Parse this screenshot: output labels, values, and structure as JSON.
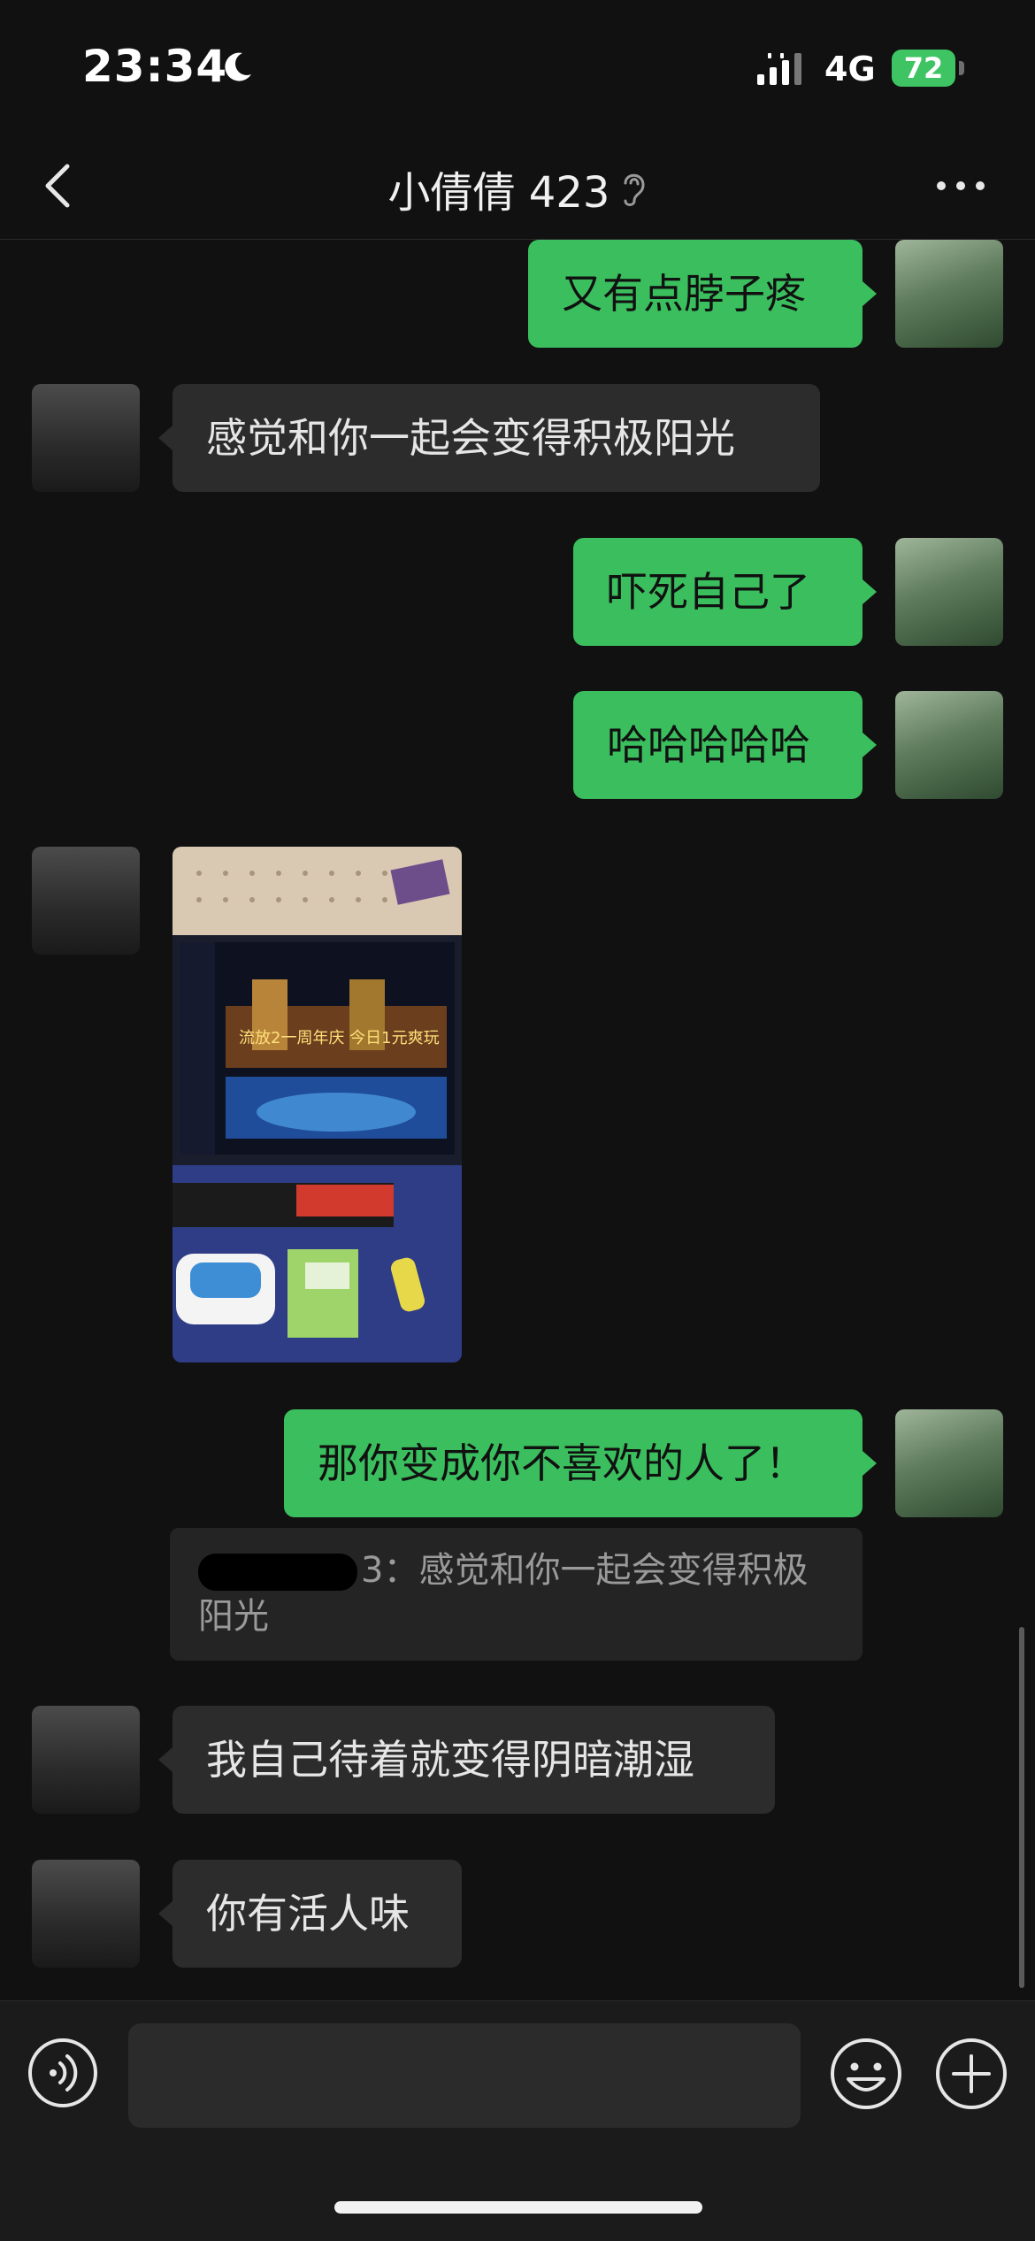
{
  "status_bar": {
    "time": "23:34",
    "network": "4G",
    "battery": "72"
  },
  "header": {
    "title": "小倩倩 423",
    "back_icon": "chevron-left-icon",
    "ear_icon": "ear-icon",
    "more_icon": "more-dots-icon"
  },
  "messages": [
    {
      "side": "out",
      "text": "又有点脖子疼"
    },
    {
      "side": "in",
      "text": "感觉和你一起会变得积极阳光"
    },
    {
      "side": "out",
      "text": "吓死自己了"
    },
    {
      "side": "out",
      "text": "哈哈哈哈哈"
    },
    {
      "side": "in",
      "type": "image",
      "image_caption": "流放2一周年庆 今日1元爽玩"
    },
    {
      "side": "out",
      "text": "那你变成你不喜欢的人了！"
    },
    {
      "side": "in",
      "text": "我自己待着就变得阴暗潮湿"
    },
    {
      "side": "in",
      "text": "你有活人味"
    }
  ],
  "quote": {
    "suffix": "3：",
    "text": "感觉和你一起会变得积极阳光"
  },
  "input_bar": {
    "placeholder": "",
    "voice_icon": "voice-icon",
    "emoji_icon": "emoji-icon",
    "plus_icon": "plus-icon"
  },
  "colors": {
    "background": "#111111",
    "outgoing_bubble": "#3bbf5e",
    "incoming_bubble": "#2c2c2c",
    "battery": "#3ec463"
  }
}
